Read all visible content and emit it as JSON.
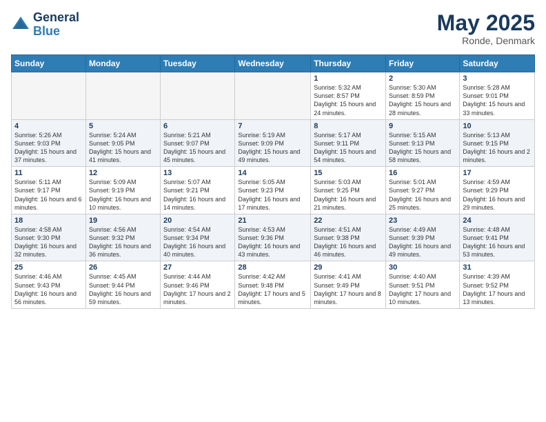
{
  "header": {
    "logo_line1": "General",
    "logo_line2": "Blue",
    "title": "May 2025",
    "subtitle": "Ronde, Denmark"
  },
  "days_of_week": [
    "Sunday",
    "Monday",
    "Tuesday",
    "Wednesday",
    "Thursday",
    "Friday",
    "Saturday"
  ],
  "weeks": [
    [
      {
        "day": "",
        "empty": true
      },
      {
        "day": "",
        "empty": true
      },
      {
        "day": "",
        "empty": true
      },
      {
        "day": "",
        "empty": true
      },
      {
        "day": "1",
        "sunrise": "5:32 AM",
        "sunset": "8:57 PM",
        "daylight": "15 hours and 24 minutes."
      },
      {
        "day": "2",
        "sunrise": "5:30 AM",
        "sunset": "8:59 PM",
        "daylight": "15 hours and 28 minutes."
      },
      {
        "day": "3",
        "sunrise": "5:28 AM",
        "sunset": "9:01 PM",
        "daylight": "15 hours and 33 minutes."
      }
    ],
    [
      {
        "day": "4",
        "sunrise": "5:26 AM",
        "sunset": "9:03 PM",
        "daylight": "15 hours and 37 minutes."
      },
      {
        "day": "5",
        "sunrise": "5:24 AM",
        "sunset": "9:05 PM",
        "daylight": "15 hours and 41 minutes."
      },
      {
        "day": "6",
        "sunrise": "5:21 AM",
        "sunset": "9:07 PM",
        "daylight": "15 hours and 45 minutes."
      },
      {
        "day": "7",
        "sunrise": "5:19 AM",
        "sunset": "9:09 PM",
        "daylight": "15 hours and 49 minutes."
      },
      {
        "day": "8",
        "sunrise": "5:17 AM",
        "sunset": "9:11 PM",
        "daylight": "15 hours and 54 minutes."
      },
      {
        "day": "9",
        "sunrise": "5:15 AM",
        "sunset": "9:13 PM",
        "daylight": "15 hours and 58 minutes."
      },
      {
        "day": "10",
        "sunrise": "5:13 AM",
        "sunset": "9:15 PM",
        "daylight": "16 hours and 2 minutes."
      }
    ],
    [
      {
        "day": "11",
        "sunrise": "5:11 AM",
        "sunset": "9:17 PM",
        "daylight": "16 hours and 6 minutes."
      },
      {
        "day": "12",
        "sunrise": "5:09 AM",
        "sunset": "9:19 PM",
        "daylight": "16 hours and 10 minutes."
      },
      {
        "day": "13",
        "sunrise": "5:07 AM",
        "sunset": "9:21 PM",
        "daylight": "16 hours and 14 minutes."
      },
      {
        "day": "14",
        "sunrise": "5:05 AM",
        "sunset": "9:23 PM",
        "daylight": "16 hours and 17 minutes."
      },
      {
        "day": "15",
        "sunrise": "5:03 AM",
        "sunset": "9:25 PM",
        "daylight": "16 hours and 21 minutes."
      },
      {
        "day": "16",
        "sunrise": "5:01 AM",
        "sunset": "9:27 PM",
        "daylight": "16 hours and 25 minutes."
      },
      {
        "day": "17",
        "sunrise": "4:59 AM",
        "sunset": "9:29 PM",
        "daylight": "16 hours and 29 minutes."
      }
    ],
    [
      {
        "day": "18",
        "sunrise": "4:58 AM",
        "sunset": "9:30 PM",
        "daylight": "16 hours and 32 minutes."
      },
      {
        "day": "19",
        "sunrise": "4:56 AM",
        "sunset": "9:32 PM",
        "daylight": "16 hours and 36 minutes."
      },
      {
        "day": "20",
        "sunrise": "4:54 AM",
        "sunset": "9:34 PM",
        "daylight": "16 hours and 40 minutes."
      },
      {
        "day": "21",
        "sunrise": "4:53 AM",
        "sunset": "9:36 PM",
        "daylight": "16 hours and 43 minutes."
      },
      {
        "day": "22",
        "sunrise": "4:51 AM",
        "sunset": "9:38 PM",
        "daylight": "16 hours and 46 minutes."
      },
      {
        "day": "23",
        "sunrise": "4:49 AM",
        "sunset": "9:39 PM",
        "daylight": "16 hours and 49 minutes."
      },
      {
        "day": "24",
        "sunrise": "4:48 AM",
        "sunset": "9:41 PM",
        "daylight": "16 hours and 53 minutes."
      }
    ],
    [
      {
        "day": "25",
        "sunrise": "4:46 AM",
        "sunset": "9:43 PM",
        "daylight": "16 hours and 56 minutes."
      },
      {
        "day": "26",
        "sunrise": "4:45 AM",
        "sunset": "9:44 PM",
        "daylight": "16 hours and 59 minutes."
      },
      {
        "day": "27",
        "sunrise": "4:44 AM",
        "sunset": "9:46 PM",
        "daylight": "17 hours and 2 minutes."
      },
      {
        "day": "28",
        "sunrise": "4:42 AM",
        "sunset": "9:48 PM",
        "daylight": "17 hours and 5 minutes."
      },
      {
        "day": "29",
        "sunrise": "4:41 AM",
        "sunset": "9:49 PM",
        "daylight": "17 hours and 8 minutes."
      },
      {
        "day": "30",
        "sunrise": "4:40 AM",
        "sunset": "9:51 PM",
        "daylight": "17 hours and 10 minutes."
      },
      {
        "day": "31",
        "sunrise": "4:39 AM",
        "sunset": "9:52 PM",
        "daylight": "17 hours and 13 minutes."
      }
    ]
  ],
  "labels": {
    "sunrise": "Sunrise:",
    "sunset": "Sunset:",
    "daylight": "Daylight:"
  }
}
